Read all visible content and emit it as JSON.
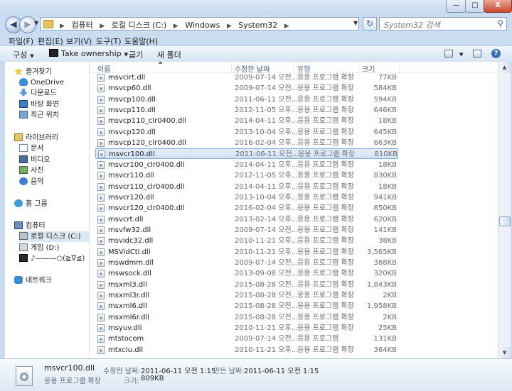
{
  "window": {
    "minimize": "—",
    "maximize": "□",
    "close": "X"
  },
  "nav": {
    "back": "◀",
    "forward": "▶",
    "refresh": "↻"
  },
  "address": {
    "crumbs": [
      "컴퓨터",
      "로컬 디스크 (C:)",
      "Windows",
      "System32"
    ]
  },
  "search": {
    "placeholder": "System32 검색"
  },
  "menus": [
    "파일(F)",
    "편집(E)",
    "보기(V)",
    "도구(T)",
    "도움말(H)"
  ],
  "toolbar": {
    "organize": "구성",
    "take_ownership": "Take ownership",
    "share": "굽기",
    "new_folder": "새 폴더"
  },
  "sidebar": {
    "favorites": "즐겨찾기",
    "fav_items": [
      "OneDrive",
      "다운로드",
      "바탕 화면",
      "최근 위치"
    ],
    "libraries": "라이브러리",
    "lib_items": [
      "문서",
      "비디오",
      "사진",
      "음악"
    ],
    "homegroup": "홈 그룹",
    "computer": "컴퓨터",
    "comp_items": [
      "로컬 디스크 (C:)",
      "게임 (D:)",
      "♪———○(≧∇≦)"
    ],
    "network": "네트워크"
  },
  "columns": {
    "name": "이름",
    "date": "수정한 날짜",
    "type": "유형",
    "size": "크기"
  },
  "files": [
    {
      "name": "msvcirt.dll",
      "date": "2009-07-14 오전...",
      "type": "응용 프로그램 확장",
      "size": "77KB"
    },
    {
      "name": "msvcp60.dll",
      "date": "2009-07-14 오전...",
      "type": "응용 프로그램 확장",
      "size": "584KB"
    },
    {
      "name": "msvcp100.dll",
      "date": "2011-06-11 오전...",
      "type": "응용 프로그램 확장",
      "size": "594KB"
    },
    {
      "name": "msvcp110.dll",
      "date": "2012-11-05 오후...",
      "type": "응용 프로그램 확장",
      "size": "646KB"
    },
    {
      "name": "msvcp110_clr0400.dll",
      "date": "2014-04-11 오후...",
      "type": "응용 프로그램 확장",
      "size": "18KB"
    },
    {
      "name": "msvcp120.dll",
      "date": "2013-10-04 오후...",
      "type": "응용 프로그램 확장",
      "size": "645KB"
    },
    {
      "name": "msvcp120_clr0400.dll",
      "date": "2016-02-04 오후...",
      "type": "응용 프로그램 확장",
      "size": "663KB"
    },
    {
      "name": "msvcr100.dll",
      "date": "2011-06-11 오전...",
      "type": "응용 프로그램 확장",
      "size": "810KB"
    },
    {
      "name": "msvcr100_clr0400.dll",
      "date": "2014-04-11 오후...",
      "type": "응용 프로그램 확장",
      "size": "18KB"
    },
    {
      "name": "msvcr110.dll",
      "date": "2012-11-05 오후...",
      "type": "응용 프로그램 확장",
      "size": "830KB"
    },
    {
      "name": "msvcr110_clr0400.dll",
      "date": "2014-04-11 오후...",
      "type": "응용 프로그램 확장",
      "size": "18KB"
    },
    {
      "name": "msvcr120.dll",
      "date": "2013-10-04 오후...",
      "type": "응용 프로그램 확장",
      "size": "941KB"
    },
    {
      "name": "msvcr120_clr0400.dll",
      "date": "2016-02-04 오후...",
      "type": "응용 프로그램 확장",
      "size": "850KB"
    },
    {
      "name": "msvcrt.dll",
      "date": "2013-02-14 오후...",
      "type": "응용 프로그램 확장",
      "size": "620KB"
    },
    {
      "name": "msvfw32.dll",
      "date": "2009-07-14 오전...",
      "type": "응용 프로그램 확장",
      "size": "141KB"
    },
    {
      "name": "msvidc32.dll",
      "date": "2010-11-21 오후...",
      "type": "응용 프로그램 확장",
      "size": "38KB"
    },
    {
      "name": "MSVidCtl.dll",
      "date": "2010-11-21 오후...",
      "type": "응용 프로그램 확장",
      "size": "3,565KB"
    },
    {
      "name": "mswdmm.dll",
      "date": "2009-07-14 오전...",
      "type": "응용 프로그램 확장",
      "size": "388KB"
    },
    {
      "name": "mswsock.dll",
      "date": "2013-09-08 오전...",
      "type": "응용 프로그램 확장",
      "size": "320KB"
    },
    {
      "name": "msxml3.dll",
      "date": "2015-08-28 오전...",
      "type": "응용 프로그램 확장",
      "size": "1,843KB"
    },
    {
      "name": "msxml3r.dll",
      "date": "2015-08-28 오전...",
      "type": "응용 프로그램 확장",
      "size": "2KB"
    },
    {
      "name": "msxml6.dll",
      "date": "2015-08-28 오전...",
      "type": "응용 프로그램 확장",
      "size": "1,958KB"
    },
    {
      "name": "msxml6r.dll",
      "date": "2015-08-28 오전...",
      "type": "응용 프로그램 확장",
      "size": "2KB"
    },
    {
      "name": "msyuv.dll",
      "date": "2010-11-21 오후...",
      "type": "응용 프로그램 확장",
      "size": "25KB"
    },
    {
      "name": "mtstocom",
      "date": "2009-07-14 오전...",
      "type": "응용 프로그램",
      "size": "131KB"
    },
    {
      "name": "mtxclu.dll",
      "date": "2010-11-21 오후...",
      "type": "응용 프로그램 확장",
      "size": "364KB"
    }
  ],
  "details": {
    "filename": "msvcr100.dll",
    "filetype": "응용 프로그램 확장",
    "modified_label": "수정한 날짜:",
    "modified_value": "2011-06-11 오전 1:15",
    "size_label": "크기:",
    "size_value": "809KB",
    "created_label": "만든 날짜:",
    "created_value": "2011-06-11 오전 1:15"
  }
}
